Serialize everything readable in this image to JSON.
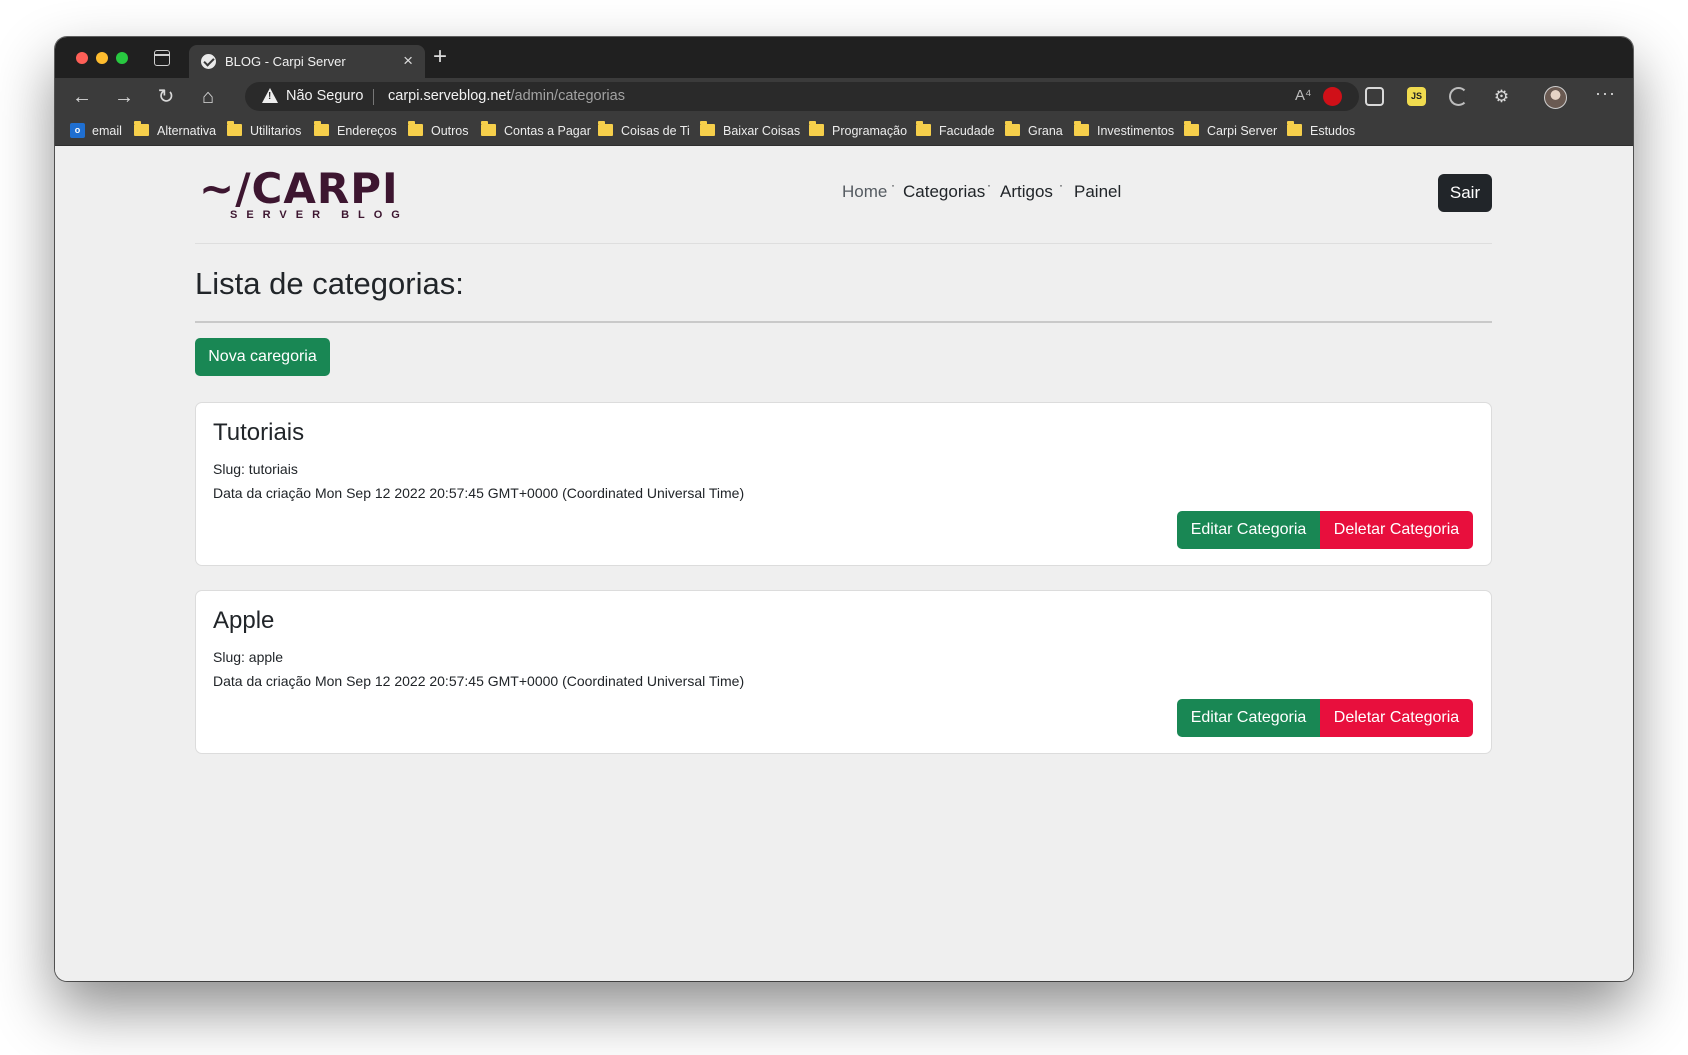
{
  "browser": {
    "tab_title": "BLOG - Carpi Server",
    "tab_close": "×",
    "new_tab": "+",
    "security_label": "Não Seguro",
    "url_host": "carpi.serveblog.net",
    "url_path": "/admin/categorias",
    "read_aloud": "A⁴",
    "js_ext": "JS",
    "menu": "···"
  },
  "bookmarks": [
    {
      "label": "email",
      "icon": "outlook-icon"
    },
    {
      "label": "Alternativa",
      "icon": "folder-icon"
    },
    {
      "label": "Utilitarios",
      "icon": "folder-icon"
    },
    {
      "label": "Endereços",
      "icon": "folder-icon"
    },
    {
      "label": "Outros",
      "icon": "folder-icon"
    },
    {
      "label": "Contas a Pagar",
      "icon": "folder-icon"
    },
    {
      "label": "Coisas de Ti",
      "icon": "folder-icon"
    },
    {
      "label": "Baixar Coisas",
      "icon": "folder-icon"
    },
    {
      "label": "Programação",
      "icon": "folder-icon"
    },
    {
      "label": "Facudade",
      "icon": "folder-icon"
    },
    {
      "label": "Grana",
      "icon": "folder-icon"
    },
    {
      "label": "Investimentos",
      "icon": "folder-icon"
    },
    {
      "label": "Carpi Server",
      "icon": "folder-icon"
    },
    {
      "label": "Estudos",
      "icon": "folder-icon"
    }
  ],
  "site": {
    "logo_main": "~/CARPI",
    "logo_sub": "SERVER BLOG",
    "nav": [
      "Home",
      "Categorias",
      "Artigos",
      "Painel"
    ],
    "nav_separator": "·",
    "logout_label": "Sair"
  },
  "main": {
    "title": "Lista de categorias:",
    "new_button": "Nova caregoria",
    "categories": [
      {
        "title": "Tutoriais",
        "slug": "Slug: tutoriais",
        "created": "Data da criação Mon Sep 12 2022 20:57:45 GMT+0000 (Coordinated Universal Time)",
        "edit_label": "Editar Categoria",
        "delete_label": "Deletar Categoria"
      },
      {
        "title": "Apple",
        "slug": "Slug: apple",
        "created": "Data da criação Mon Sep 12 2022 20:57:45 GMT+0000 (Coordinated Universal Time)",
        "edit_label": "Editar Categoria",
        "delete_label": "Deletar Categoria"
      }
    ]
  },
  "colors": {
    "success": "#198754",
    "danger": "#e80f3d",
    "dark": "#212529",
    "brand": "#3d1630"
  }
}
